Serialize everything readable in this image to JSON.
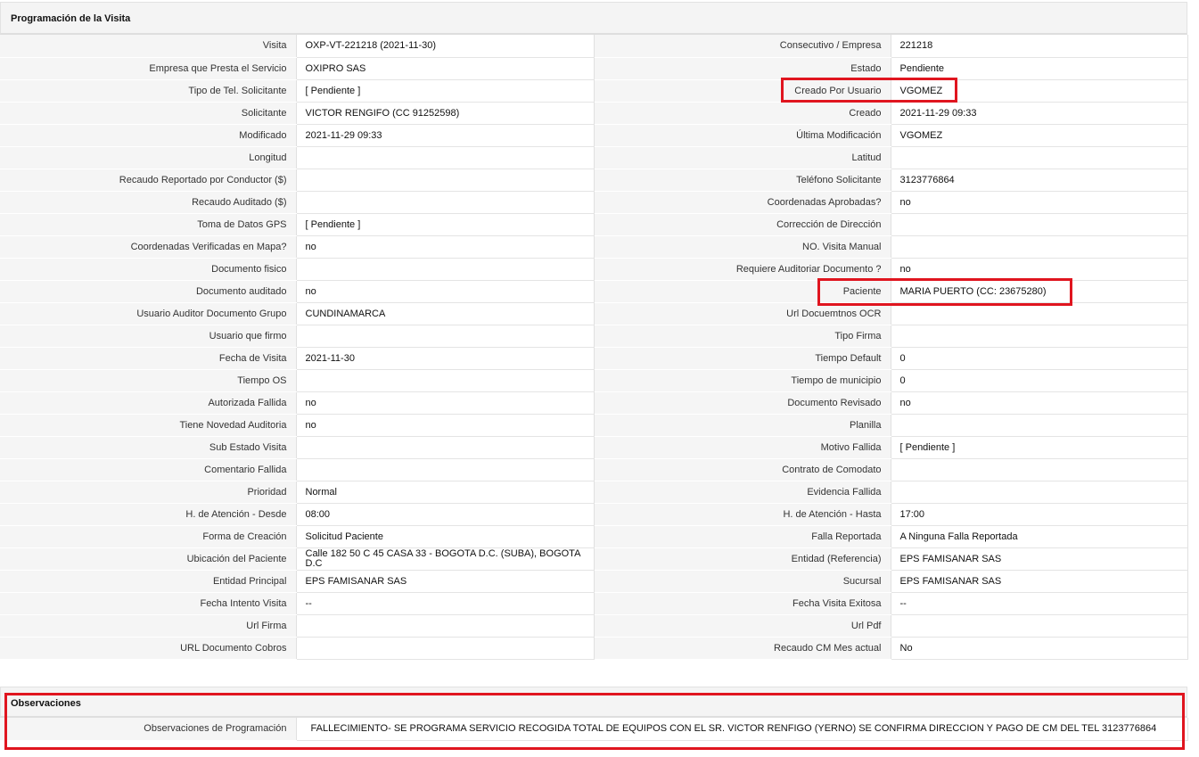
{
  "visit_section": {
    "title": "Programación de la Visita",
    "rows": [
      {
        "l1": "Visita",
        "v1": "OXP-VT-221218 (2021-11-30)",
        "l2": "Consecutivo / Empresa",
        "v2": "221218"
      },
      {
        "l1": "Empresa que Presta el Servicio",
        "v1": "OXIPRO SAS",
        "l2": "Estado",
        "v2": "Pendiente"
      },
      {
        "l1": "Tipo de Tel. Solicitante",
        "v1": "[ Pendiente ]",
        "l2": "Creado Por Usuario",
        "v2": "VGOMEZ"
      },
      {
        "l1": "Solicitante",
        "v1": "VICTOR RENGIFO (CC 91252598)",
        "l2": "Creado",
        "v2": "2021-11-29 09:33"
      },
      {
        "l1": "Modificado",
        "v1": "2021-11-29 09:33",
        "l2": "Última Modificación",
        "v2": " VGOMEZ"
      },
      {
        "l1": "Longitud",
        "v1": "",
        "l2": "Latitud",
        "v2": ""
      },
      {
        "l1": "Recaudo Reportado por Conductor ($)",
        "v1": "",
        "l2": "Teléfono Solicitante",
        "v2": "3123776864"
      },
      {
        "l1": "Recaudo Auditado ($)",
        "v1": "",
        "l2": "Coordenadas Aprobadas?",
        "v2": " no"
      },
      {
        "l1": "Toma de Datos GPS",
        "v1": "[ Pendiente ]",
        "l2": "Corrección de Dirección",
        "v2": ""
      },
      {
        "l1": "Coordenadas Verificadas en Mapa?",
        "v1": " no",
        "l2": "NO. Visita Manual",
        "v2": ""
      },
      {
        "l1": "Documento fisico",
        "v1": "",
        "l2": "Requiere Auditoriar Documento ?",
        "v2": " no"
      },
      {
        "l1": "Documento auditado",
        "v1": " no",
        "l2": "Paciente",
        "v2": "MARIA PUERTO (CC: 23675280)"
      },
      {
        "l1": "Usuario Auditor Documento Grupo",
        "v1": "CUNDINAMARCA",
        "l2": "Url Docuemtnos OCR",
        "v2": ""
      },
      {
        "l1": "Usuario que firmo",
        "v1": "",
        "l2": "Tipo Firma",
        "v2": ""
      },
      {
        "l1": "Fecha de Visita",
        "v1": " 2021-11-30",
        "l2": "Tiempo Default",
        "v2": "0"
      },
      {
        "l1": "Tiempo OS",
        "v1": "",
        "l2": "Tiempo de municipio",
        "v2": "0"
      },
      {
        "l1": "Autorizada Fallida",
        "v1": " no",
        "l2": "Documento Revisado",
        "v2": " no"
      },
      {
        "l1": "Tiene Novedad Auditoria",
        "v1": " no",
        "l2": "Planilla",
        "v2": ""
      },
      {
        "l1": "Sub Estado Visita",
        "v1": "",
        "l2": "Motivo Fallida",
        "v2": "[ Pendiente ]"
      },
      {
        "l1": "Comentario Fallida",
        "v1": "",
        "l2": "Contrato de Comodato",
        "v2": ""
      },
      {
        "l1": "Prioridad",
        "v1": "Normal",
        "l2": "Evidencia Fallida",
        "v2": ""
      },
      {
        "l1": "H. de Atención - Desde",
        "v1": "08:00",
        "l2": "H. de Atención - Hasta",
        "v2": "17:00"
      },
      {
        "l1": "Forma de Creación",
        "v1": "Solicitud Paciente",
        "l2": "Falla Reportada",
        "v2": "A Ninguna Falla Reportada"
      },
      {
        "l1": "Ubicación del Paciente",
        "v1": "Calle 182 50 C 45 CASA 33 - BOGOTA D.C. (SUBA), BOGOTA D.C",
        "l2": "Entidad (Referencia)",
        "v2": "EPS FAMISANAR SAS"
      },
      {
        "l1": "Entidad Principal",
        "v1": "EPS FAMISANAR SAS",
        "l2": "Sucursal",
        "v2": "EPS FAMISANAR SAS"
      },
      {
        "l1": "Fecha Intento Visita",
        "v1": " --",
        "l2": "Fecha Visita Exitosa",
        "v2": " --"
      },
      {
        "l1": "Url Firma",
        "v1": "",
        "l2": "Url Pdf",
        "v2": ""
      },
      {
        "l1": "URL Documento Cobros",
        "v1": "",
        "l2": "Recaudo CM Mes actual",
        "v2": "No"
      }
    ]
  },
  "observations_section": {
    "title": "Observaciones",
    "label": "Observaciones de Programación",
    "value": "FALLECIMIENTO- SE PROGRAMA SERVICIO RECOGIDA TOTAL DE EQUIPOS CON EL SR. VICTOR RENFIGO (YERNO) SE CONFIRMA DIRECCION Y PAGO DE CM DEL TEL 3123776864"
  },
  "colors": {
    "highlight": "#e0151f",
    "label_bg": "#f5f5f5",
    "header_bg": "#f4f4f4"
  }
}
